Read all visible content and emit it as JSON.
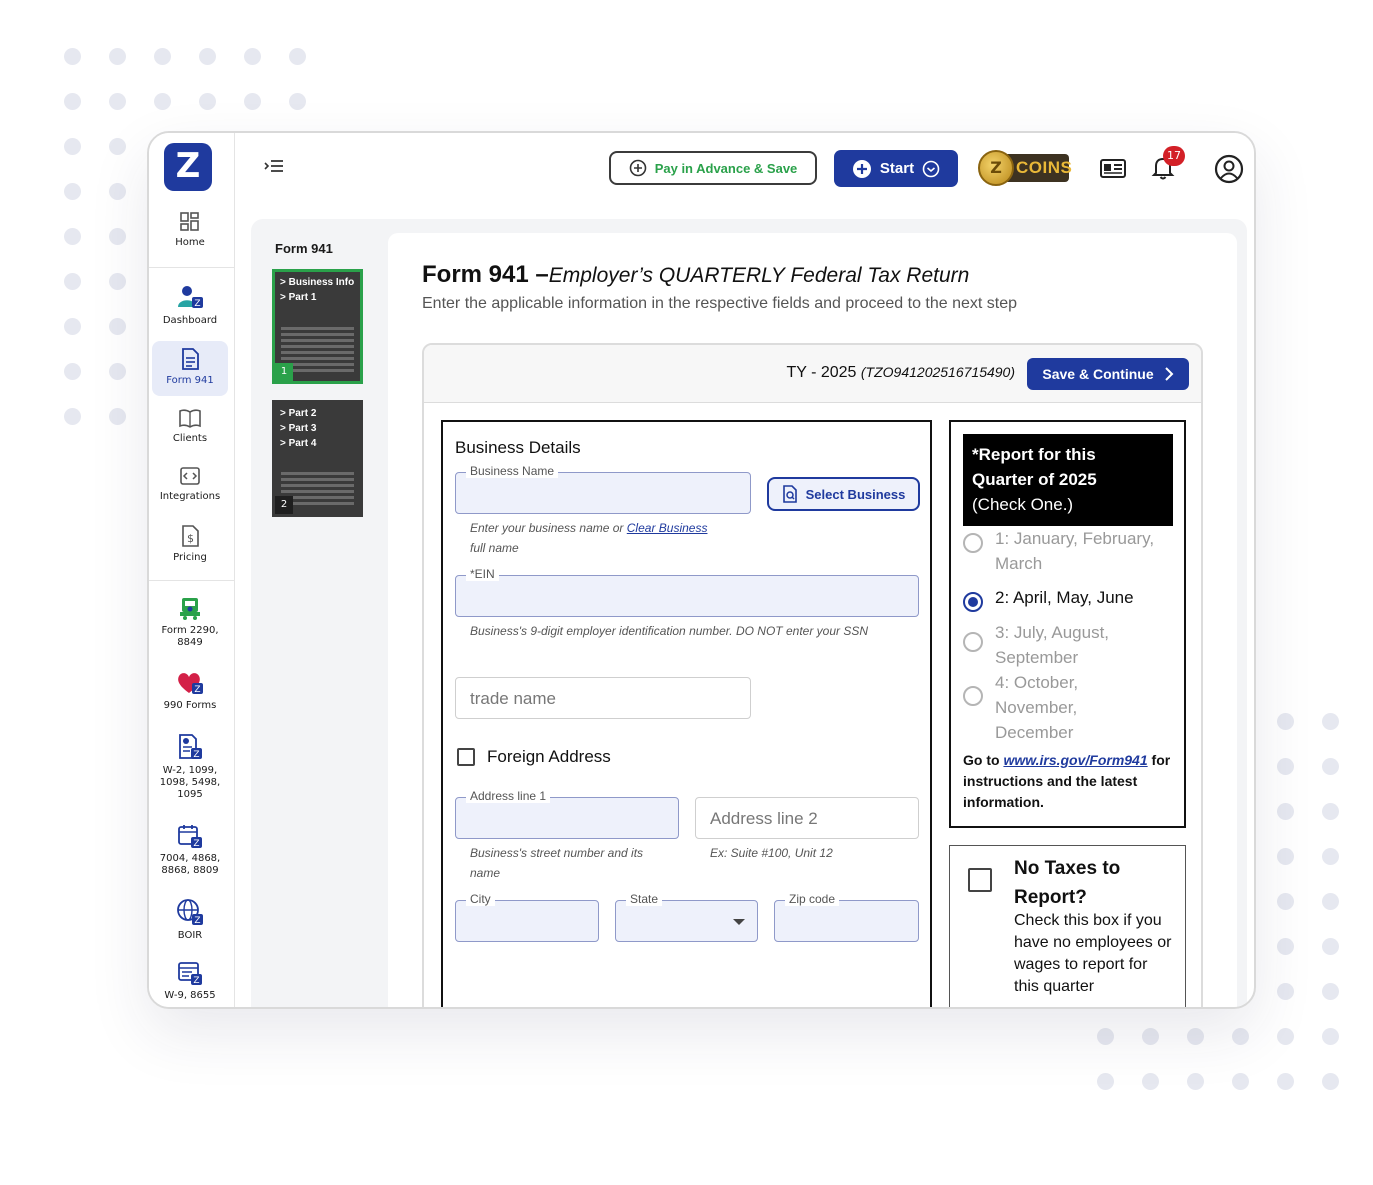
{
  "sidebar": {
    "items": [
      {
        "label": "Home"
      },
      {
        "label": "Dashboard"
      },
      {
        "label": "Form 941"
      },
      {
        "label": "Clients"
      },
      {
        "label": "Integrations"
      },
      {
        "label": "Pricing"
      },
      {
        "label": "Form 2290, 8849"
      },
      {
        "label": "990 Forms"
      },
      {
        "label": "W-2, 1099, 1098, 5498, 1095"
      },
      {
        "label": "7004, 4868, 8868, 8809"
      },
      {
        "label": "BOIR"
      },
      {
        "label": "W-9, 8655"
      }
    ]
  },
  "topbar": {
    "pay_label": "Pay in Advance & Save",
    "start_label": "Start",
    "coins_label": "COINS",
    "notification_count": "17"
  },
  "thumbs": {
    "title": "Form 941",
    "pages": [
      {
        "labels": [
          "> Business Info",
          "> Part 1"
        ],
        "number": "1"
      },
      {
        "labels": [
          "> Part 2",
          "> Part 3",
          "> Part 4"
        ],
        "number": "2"
      }
    ]
  },
  "form": {
    "title_bold": "Form 941 –",
    "title_italic": "Employer’s QUARTERLY Federal Tax Return",
    "subtitle": "Enter the applicable information in the respective fields and proceed to the next step",
    "ty_label": "TY - 2025",
    "ty_id": "(TZO941202516715490)",
    "save_label": "Save & Continue"
  },
  "business": {
    "title": "Business Details",
    "name_label": "Business Name",
    "select_label": "Select Business",
    "name_hint": "Enter your business name or",
    "name_hint_link": "Clear Business",
    "name_hint_tail": "full name",
    "ein_label": "*EIN",
    "ein_hint": "Business's 9-digit employer identification number. DO NOT enter your SSN",
    "trade_placeholder": "trade name",
    "foreign_label": "Foreign Address",
    "addr1_label": "Address line 1",
    "addr1_hint": "Business's street number and its name",
    "addr2_placeholder": "Address line 2",
    "addr2_hint": "Ex: Suite #100, Unit 12",
    "city_label": "City",
    "state_label": "State",
    "zip_label": "Zip code"
  },
  "quarter": {
    "head_line1": "*Report for this",
    "head_line2": "Quarter of 2025",
    "head_line3": "(Check One.)",
    "options": [
      {
        "label": "1: January, February, March",
        "selected": false
      },
      {
        "label": "2: April, May, June",
        "selected": true
      },
      {
        "label": "3: July, August, September",
        "selected": false
      },
      {
        "label": "4: October, November, December",
        "selected": false
      }
    ],
    "foot_pre": "Go to",
    "foot_link": "www.irs.gov/Form941",
    "foot_post": "for instructions and the latest information."
  },
  "notax": {
    "title": "No Taxes to Report?",
    "text": "Check this box if you have no employees or wages to report for this quarter"
  },
  "colors": {
    "primary": "#1f3a9e",
    "green": "#2aa14a",
    "badge": "#d32027"
  }
}
